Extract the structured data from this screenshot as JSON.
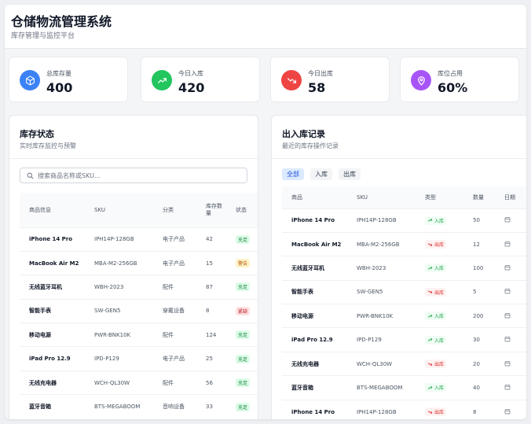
{
  "header": {
    "title": "仓储物流管理系统",
    "subtitle": "库存管理与监控平台"
  },
  "stats": [
    {
      "label": "总库存量",
      "value": "400",
      "color": "#3b82f6",
      "icon": "cube-icon"
    },
    {
      "label": "今日入库",
      "value": "420",
      "color": "#22c55e",
      "icon": "trend-up-icon"
    },
    {
      "label": "今日出库",
      "value": "58",
      "color": "#ef4444",
      "icon": "trend-down-icon"
    },
    {
      "label": "库位占用",
      "value": "60%",
      "color": "#a855f7",
      "icon": "location-pin-icon"
    }
  ],
  "inventory": {
    "title": "库存状态",
    "subtitle": "实时库存监控与预警",
    "search_placeholder": "搜索商品名称或SKU...",
    "columns": [
      "商品信息",
      "SKU",
      "分类",
      "库存数量",
      "状态"
    ],
    "rows": [
      {
        "name": "iPhone 14 Pro",
        "sku": "IPH14P-128GB",
        "category": "电子产品",
        "qty": "42",
        "status": "充足",
        "status_kind": "ok"
      },
      {
        "name": "MacBook Air M2",
        "sku": "MBA-M2-256GB",
        "category": "电子产品",
        "qty": "15",
        "status": "警告",
        "status_kind": "warn"
      },
      {
        "name": "无线蓝牙耳机",
        "sku": "WBH-2023",
        "category": "配件",
        "qty": "87",
        "status": "充足",
        "status_kind": "ok"
      },
      {
        "name": "智能手表",
        "sku": "SW-GEN5",
        "category": "穿戴设备",
        "qty": "8",
        "status": "紧缺",
        "status_kind": "low"
      },
      {
        "name": "移动电源",
        "sku": "PWR-BNK10K",
        "category": "配件",
        "qty": "124",
        "status": "充足",
        "status_kind": "ok"
      },
      {
        "name": "iPad Pro 12.9",
        "sku": "IPD-P129",
        "category": "电子产品",
        "qty": "25",
        "status": "充足",
        "status_kind": "ok"
      },
      {
        "name": "无线充电器",
        "sku": "WCH-QL30W",
        "category": "配件",
        "qty": "56",
        "status": "充足",
        "status_kind": "ok"
      },
      {
        "name": "蓝牙音箱",
        "sku": "BTS-MEGABOOM",
        "category": "音响设备",
        "qty": "33",
        "status": "充足",
        "status_kind": "ok"
      }
    ]
  },
  "records": {
    "title": "出入库记录",
    "subtitle": "最近的库存操作记录",
    "filters": [
      "全部",
      "入库",
      "出库"
    ],
    "columns": [
      "商品",
      "SKU",
      "类型",
      "数量",
      "日期"
    ],
    "rows": [
      {
        "name": "iPhone 14 Pro",
        "sku": "IPH14P-128GB",
        "type": "入库",
        "type_kind": "in",
        "qty": "50"
      },
      {
        "name": "MacBook Air M2",
        "sku": "MBA-M2-256GB",
        "type": "出库",
        "type_kind": "out",
        "qty": "12"
      },
      {
        "name": "无线蓝牙耳机",
        "sku": "WBH-2023",
        "type": "入库",
        "type_kind": "in",
        "qty": "100"
      },
      {
        "name": "智能手表",
        "sku": "SW-GEN5",
        "type": "出库",
        "type_kind": "out",
        "qty": "5"
      },
      {
        "name": "移动电源",
        "sku": "PWR-BNK10K",
        "type": "入库",
        "type_kind": "in",
        "qty": "200"
      },
      {
        "name": "iPad Pro 12.9",
        "sku": "IPD-P129",
        "type": "入库",
        "type_kind": "in",
        "qty": "30"
      },
      {
        "name": "无线充电器",
        "sku": "WCH-QL30W",
        "type": "出库",
        "type_kind": "out",
        "qty": "20"
      },
      {
        "name": "蓝牙音箱",
        "sku": "BTS-MEGABOOM",
        "type": "入库",
        "type_kind": "in",
        "qty": "40"
      },
      {
        "name": "iPhone 14 Pro",
        "sku": "IPH14P-128GB",
        "type": "出库",
        "type_kind": "out",
        "qty": "8"
      }
    ]
  }
}
